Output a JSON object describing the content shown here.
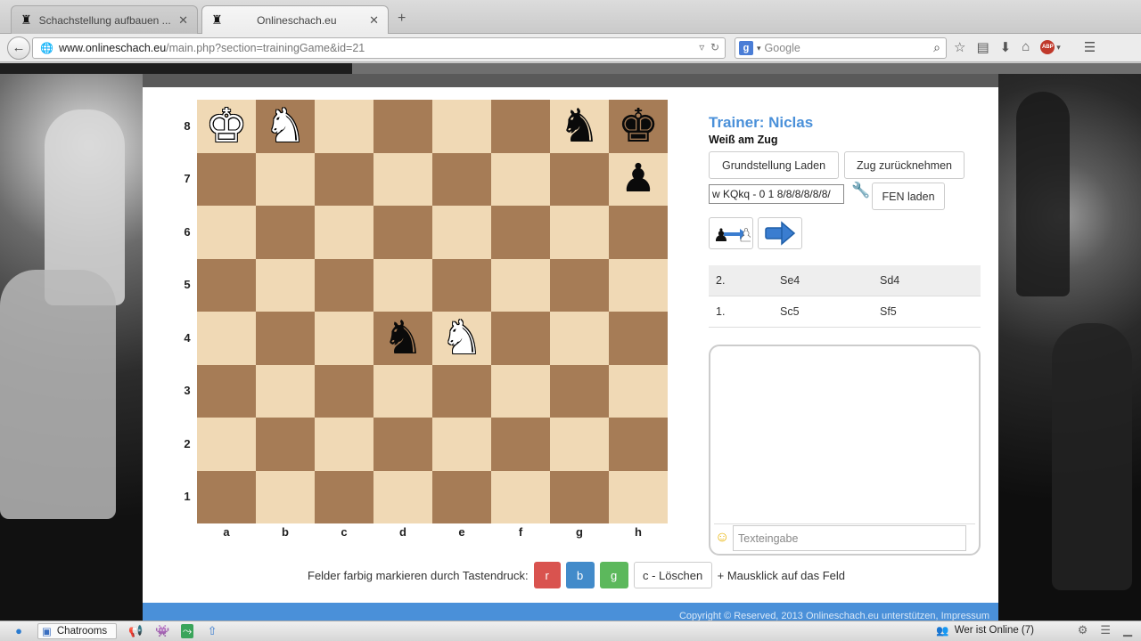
{
  "browser": {
    "tabs": [
      {
        "title": "Schachstellung aufbauen ...",
        "active": false
      },
      {
        "title": "Onlineschach.eu",
        "active": true
      }
    ],
    "url_host": "www.onlineschach.eu",
    "url_path": "/main.php?section=trainingGame&id=21",
    "search_placeholder": "Google"
  },
  "trainer": {
    "title": "Trainer: Niclas",
    "turn": "Weiß am Zug"
  },
  "buttons": {
    "reset": "Grundstellung Laden",
    "undo": "Zug zurücknehmen",
    "fen_load": "FEN laden"
  },
  "fen_value": "/8/8/8/8/8/8 w KQkq - 0 1",
  "board": {
    "files": [
      "a",
      "b",
      "c",
      "d",
      "e",
      "f",
      "g",
      "h"
    ],
    "ranks": [
      "8",
      "7",
      "6",
      "5",
      "4",
      "3",
      "2",
      "1"
    ],
    "pieces": [
      {
        "square": "a8",
        "glyph": "♚",
        "color": "white",
        "name": "white-king"
      },
      {
        "square": "b8",
        "glyph": "♞",
        "color": "white",
        "name": "white-knight"
      },
      {
        "square": "g8",
        "glyph": "♞",
        "color": "black",
        "name": "black-knight"
      },
      {
        "square": "h8",
        "glyph": "♚",
        "color": "black",
        "name": "black-king"
      },
      {
        "square": "h7",
        "glyph": "♟",
        "color": "black",
        "name": "black-pawn"
      },
      {
        "square": "d4",
        "glyph": "♞",
        "color": "black",
        "name": "black-knight"
      },
      {
        "square": "e4",
        "glyph": "♞",
        "color": "white",
        "name": "white-knight"
      }
    ]
  },
  "marking": {
    "text": "Felder farbig markieren durch Tastendruck:",
    "r": "r",
    "b": "b",
    "g": "g",
    "clear": "c - Löschen",
    "suffix": "+ Mausklick auf das Feld"
  },
  "moves": [
    {
      "num": "2.",
      "white": "Se4",
      "black": "Sd4"
    },
    {
      "num": "1.",
      "white": "Sc5",
      "black": "Sf5"
    }
  ],
  "chat": {
    "placeholder": "Texteingabe"
  },
  "footer": "Copyright © Reserved, 2013 Onlineschach.eu unterstützen, Impressum",
  "taskbar": {
    "chatrooms": "Chatrooms",
    "online": "Wer ist Online (7)"
  },
  "colors": {
    "accent": "#4a90d9",
    "light_square": "#f0d9b5",
    "dark_square": "#a67c56"
  }
}
